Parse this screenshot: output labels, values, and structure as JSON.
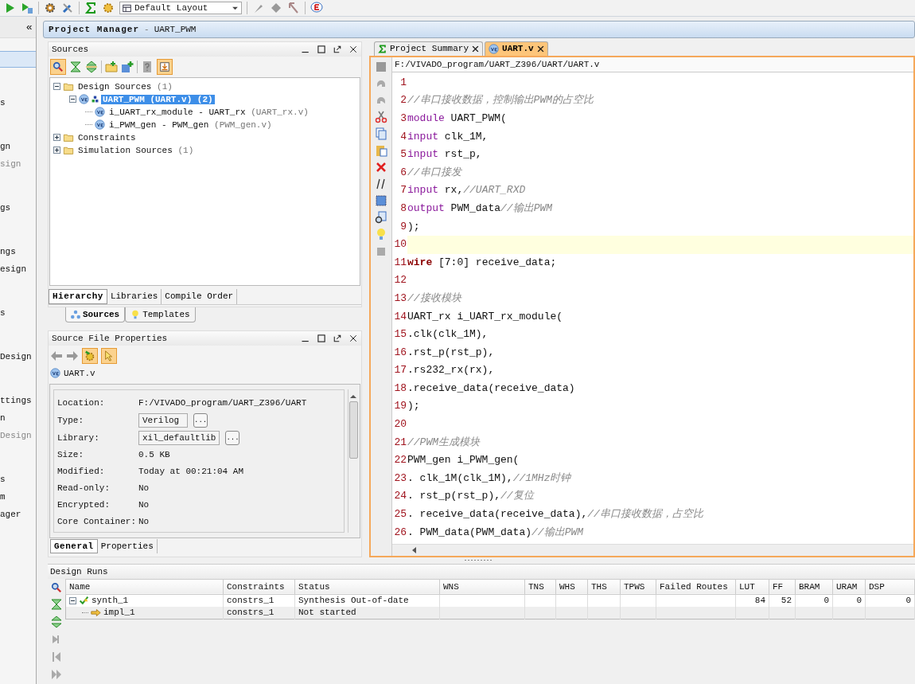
{
  "toolbar": {
    "layout_dropdown": "Default Layout"
  },
  "flow_navigator": {
    "collapse_glyph": "«",
    "groups": [
      [
        {
          "selected": true
        }
      ],
      [
        {
          "label": "s",
          "selected": false,
          "disabled": false
        }
      ],
      [
        {
          "label": "gn",
          "selected": false,
          "disabled": false
        },
        {
          "label": "sign",
          "selected": false,
          "disabled": true
        }
      ],
      [
        {
          "label": "gs",
          "selected": false,
          "disabled": false
        }
      ],
      [
        {
          "label": "ngs",
          "selected": false,
          "disabled": false
        },
        {
          "label": "esign",
          "selected": false,
          "disabled": false
        }
      ],
      [
        {
          "label": "s",
          "selected": false,
          "disabled": false
        }
      ],
      [
        {
          "label": "Design",
          "selected": false,
          "disabled": false
        }
      ],
      [
        {
          "label": "ttings",
          "selected": false,
          "disabled": false
        },
        {
          "label": "n",
          "selected": false,
          "disabled": false
        },
        {
          "label": "Design",
          "selected": false,
          "disabled": true
        }
      ],
      [
        {
          "label": "s",
          "selected": false,
          "disabled": false
        },
        {
          "label": "m",
          "selected": false,
          "disabled": false
        },
        {
          "label": "ager",
          "selected": false,
          "disabled": false
        }
      ]
    ]
  },
  "project_manager": {
    "title": "Project Manager",
    "separator": "-",
    "project": "UART_PWM"
  },
  "sources": {
    "title": "Sources",
    "tree": [
      {
        "label": "Design Sources",
        "count": "(1)",
        "kind": "folder",
        "expanded": true,
        "selected": false,
        "children": [
          {
            "label": "UART_PWM",
            "file": "(UART.v)",
            "count": "(2)",
            "kind": "top",
            "expanded": true,
            "selected": true,
            "children": [
              {
                "label": "i_UART_rx_module - UART_rx",
                "file": "(UART_rx.v)",
                "kind": "module",
                "selected": false
              },
              {
                "label": "i_PWM_gen - PWM_gen",
                "file": "(PWM_gen.v)",
                "kind": "module",
                "selected": false
              }
            ]
          }
        ]
      },
      {
        "label": "Constraints",
        "kind": "folder",
        "expanded": false,
        "selected": false
      },
      {
        "label": "Simulation Sources",
        "count": "(1)",
        "kind": "folder",
        "expanded": false,
        "selected": false
      }
    ],
    "view_tabs": [
      {
        "label": "Hierarchy",
        "selected": true
      },
      {
        "label": "Libraries",
        "selected": false
      },
      {
        "label": "Compile Order",
        "selected": false
      }
    ],
    "bottom_tabs": [
      {
        "label": "Sources",
        "selected": true
      },
      {
        "label": "Templates",
        "selected": false
      }
    ]
  },
  "source_file_properties": {
    "title": "Source File Properties",
    "file": "UART.v",
    "rows": [
      {
        "label": "Location:",
        "value": "F:/VIVADO_program/UART_Z396/UART",
        "kind": "text"
      },
      {
        "label": "Type:",
        "value": "Verilog",
        "kind": "field",
        "button": "..."
      },
      {
        "label": "Library:",
        "value": "xil_defaultlib",
        "kind": "field",
        "button": "..."
      },
      {
        "label": "Size:",
        "value": "0.5 KB",
        "kind": "text"
      },
      {
        "label": "Modified:",
        "value": "Today at 00:21:04 AM",
        "kind": "text"
      },
      {
        "label": "Read-only:",
        "value": "No",
        "kind": "text"
      },
      {
        "label": "Encrypted:",
        "value": "No",
        "kind": "text"
      },
      {
        "label": "Core Container:",
        "value": "No",
        "kind": "text"
      }
    ],
    "tabs": [
      {
        "label": "General",
        "selected": true
      },
      {
        "label": "Properties",
        "selected": false
      }
    ]
  },
  "editor": {
    "tabs": [
      {
        "label": "Project Summary",
        "kind": "summary",
        "selected": false
      },
      {
        "label": "UART.v",
        "kind": "verilog",
        "selected": true
      }
    ],
    "path": "F:/VIVADO_program/UART_Z396/UART/UART.v",
    "lines": [
      {
        "number": "1",
        "current": false
      },
      {
        "number": "2",
        "current": false,
        "tokens": [
          {
            "kind": "comment",
            "text": "//串口接收数据，控制输出PWM的占空比"
          }
        ]
      },
      {
        "number": "3",
        "current": false,
        "tokens": [
          {
            "kind": "keyword",
            "text": "module"
          },
          {
            "kind": "plain",
            "text": " UART_PWM("
          }
        ]
      },
      {
        "number": "4",
        "current": false,
        "tokens": [
          {
            "kind": "keyword",
            "text": "input"
          },
          {
            "kind": "plain",
            "text": " clk_1M,"
          }
        ]
      },
      {
        "number": "5",
        "current": false,
        "tokens": [
          {
            "kind": "keyword",
            "text": "input"
          },
          {
            "kind": "plain",
            "text": " rst_p,"
          }
        ]
      },
      {
        "number": "6",
        "current": false,
        "tokens": [
          {
            "kind": "comment",
            "text": "//串口接发"
          }
        ]
      },
      {
        "number": "7",
        "current": false,
        "tokens": [
          {
            "kind": "keyword",
            "text": "input"
          },
          {
            "kind": "plain",
            "text": " rx,"
          },
          {
            "kind": "comment",
            "text": "//UART_RXD"
          }
        ]
      },
      {
        "number": "8",
        "current": false,
        "tokens": [
          {
            "kind": "keyword",
            "text": "output"
          },
          {
            "kind": "plain",
            "text": " PWM_data"
          },
          {
            "kind": "comment",
            "text": "//输出PWM"
          }
        ]
      },
      {
        "number": "9",
        "current": false,
        "tokens": [
          {
            "kind": "plain",
            "text": ");"
          }
        ]
      },
      {
        "number": "10",
        "current": true
      },
      {
        "number": "11",
        "current": false,
        "tokens": [
          {
            "kind": "type",
            "text": "wire"
          },
          {
            "kind": "plain",
            "text": " [7:0] receive_data;"
          }
        ]
      },
      {
        "number": "12",
        "current": false
      },
      {
        "number": "13",
        "current": false,
        "tokens": [
          {
            "kind": "comment",
            "text": "//接收模块"
          }
        ]
      },
      {
        "number": "14",
        "current": false,
        "tokens": [
          {
            "kind": "plain",
            "text": "UART_rx i_UART_rx_module("
          }
        ]
      },
      {
        "number": "15",
        "current": false,
        "tokens": [
          {
            "kind": "plain",
            "text": ".clk(clk_1M),"
          }
        ]
      },
      {
        "number": "16",
        "current": false,
        "tokens": [
          {
            "kind": "plain",
            "text": ".rst_p(rst_p),"
          }
        ]
      },
      {
        "number": "17",
        "current": false,
        "tokens": [
          {
            "kind": "plain",
            "text": ".rs232_rx(rx),"
          }
        ]
      },
      {
        "number": "18",
        "current": false,
        "tokens": [
          {
            "kind": "plain",
            "text": ".receive_data(receive_data)"
          }
        ]
      },
      {
        "number": "19",
        "current": false,
        "tokens": [
          {
            "kind": "plain",
            "text": ");"
          }
        ]
      },
      {
        "number": "20",
        "current": false
      },
      {
        "number": "21",
        "current": false,
        "tokens": [
          {
            "kind": "comment",
            "text": "//PWM生成模块"
          }
        ]
      },
      {
        "number": "22",
        "current": false,
        "tokens": [
          {
            "kind": "plain",
            "text": "PWM_gen i_PWM_gen("
          }
        ]
      },
      {
        "number": "23",
        "current": false,
        "tokens": [
          {
            "kind": "plain",
            "text": ". clk_1M(clk_1M),"
          },
          {
            "kind": "comment",
            "text": "//1MHz时钟"
          }
        ]
      },
      {
        "number": "24",
        "current": false,
        "tokens": [
          {
            "kind": "plain",
            "text": ". rst_p(rst_p),"
          },
          {
            "kind": "comment",
            "text": "//复位"
          }
        ]
      },
      {
        "number": "25",
        "current": false,
        "tokens": [
          {
            "kind": "plain",
            "text": ". receive_data(receive_data),"
          },
          {
            "kind": "comment",
            "text": "//串口接收数据，占空比"
          }
        ]
      },
      {
        "number": "26",
        "current": false,
        "tokens": [
          {
            "kind": "plain",
            "text": ". PWM_data(PWM_data)"
          },
          {
            "kind": "comment",
            "text": "//输出PWM"
          }
        ]
      }
    ]
  },
  "design_runs": {
    "title": "Design Runs",
    "columns": [
      "Name",
      "Constraints",
      "Status",
      "WNS",
      "TNS",
      "WHS",
      "THS",
      "TPWS",
      "Failed Routes",
      "LUT",
      "FF",
      "BRAM",
      "URAM",
      "DSP"
    ],
    "rows": [
      {
        "kind": "synthesis",
        "expanded": true,
        "cells": [
          "synth_1",
          "constrs_1",
          "Synthesis Out-of-date",
          null,
          null,
          null,
          null,
          null,
          null,
          "84",
          "52",
          "0",
          "0",
          "0"
        ],
        "children": [
          {
            "kind": "implementation",
            "cells": [
              "impl_1",
              "constrs_1",
              "Not started",
              null,
              null,
              null,
              null,
              null,
              null,
              null,
              null,
              null,
              null,
              null
            ]
          }
        ]
      }
    ]
  }
}
